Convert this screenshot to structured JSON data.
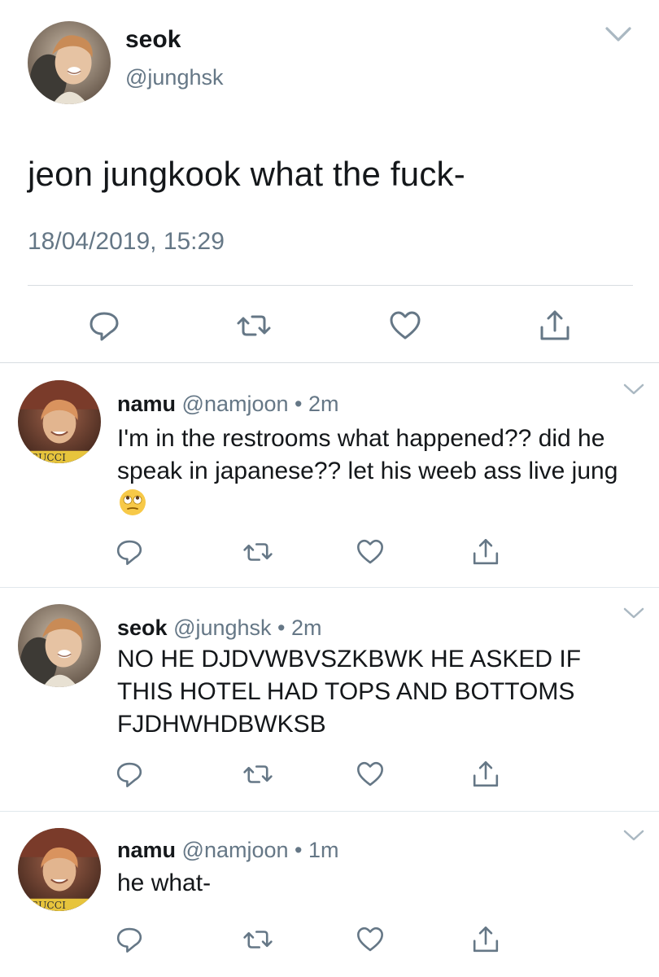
{
  "main_tweet": {
    "name": "seok",
    "handle": "@junghsk",
    "text": "jeon jungkook what the fuck-",
    "timestamp": "18/04/2019, 15:29",
    "avatar": "avatar-seok",
    "icons": [
      "reply-icon",
      "retweet-icon",
      "like-icon",
      "share-icon",
      "chevron-down-icon"
    ]
  },
  "replies": [
    {
      "name": "namu",
      "handle": "@namjoon",
      "time": "2m",
      "text": "I'm in the restrooms what happened?? did he speak in japanese?? let his weeb ass live jung",
      "emoji": "eye-roll-emoji",
      "avatar": "avatar-namu"
    },
    {
      "name": "seok",
      "handle": "@junghsk",
      "time": "2m",
      "text": "NO HE DJDVWBVSZKBWK HE ASKED IF THIS HOTEL HAD TOPS AND BOTTOMS FJDHWHDBWKSB",
      "avatar": "avatar-seok"
    },
    {
      "name": "namu",
      "handle": "@namjoon",
      "time": "1m",
      "text": "he what-",
      "avatar": "avatar-namu"
    }
  ],
  "separator": " • ",
  "colors": {
    "text_primary": "#14171a",
    "text_secondary": "#657786",
    "divider": "#e1e8ed",
    "icon": "#657786"
  }
}
